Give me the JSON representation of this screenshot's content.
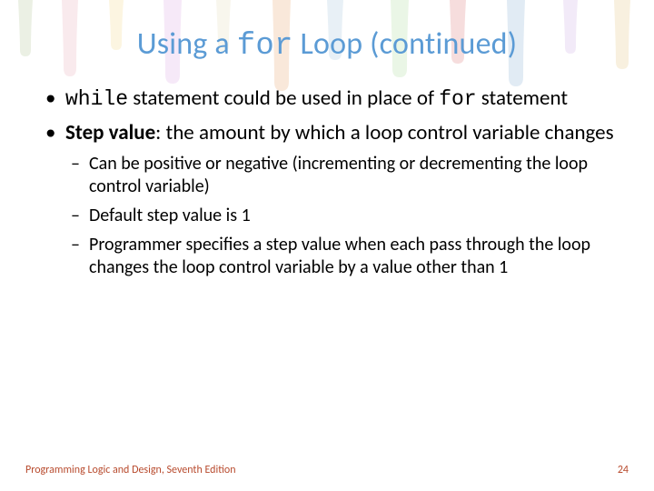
{
  "title": {
    "pre": "Using a ",
    "code": "for",
    "post": " Loop (continued)"
  },
  "bullets": [
    {
      "parts": [
        {
          "t": "while",
          "cls": "mono"
        },
        {
          "t": " statement could be used in place of "
        },
        {
          "t": "for",
          "cls": "mono"
        },
        {
          "t": " statement"
        }
      ]
    },
    {
      "parts": [
        {
          "t": "Step value",
          "cls": "bold"
        },
        {
          "t": ": the amount by which a loop control variable changes"
        }
      ],
      "sub": [
        "Can be positive or negative (incrementing or decrementing the loop control variable)",
        "Default step value is 1",
        "Programmer specifies a step value when each pass through the loop changes the loop control variable by a value other than 1"
      ]
    }
  ],
  "footer": {
    "left": "Programming Logic and Design, Seventh Edition",
    "right": "24"
  }
}
